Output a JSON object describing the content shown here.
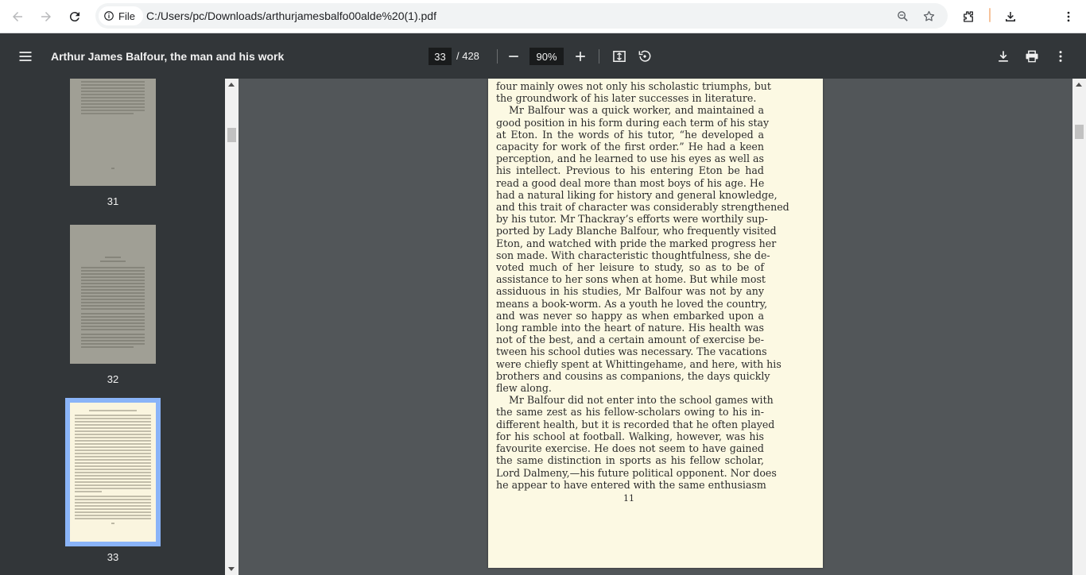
{
  "browser": {
    "site_label": "File",
    "url": "C:/Users/pc/Downloads/arthurjamesbalfo00alde%20(1).pdf",
    "icons": [
      "back-arrow-icon",
      "forward-arrow-icon",
      "reload-icon",
      "info-icon",
      "zoom-icon",
      "star-icon",
      "extensions-icon",
      "download-icon",
      "more-vert-icon"
    ]
  },
  "toolbar": {
    "title": "Arthur James Balfour, the man and his work",
    "current_page": "33",
    "total_pages": "/ 428",
    "zoom": "90%",
    "icons": [
      "menu-icon",
      "zoom-out-icon",
      "zoom-in-icon",
      "fit-page-icon",
      "rotate-icon",
      "download-icon",
      "print-icon",
      "more-vert-icon"
    ]
  },
  "thumbnails": [
    {
      "label": "31",
      "selected": false
    },
    {
      "label": "32",
      "selected": false
    },
    {
      "label": "33",
      "selected": true
    }
  ],
  "page": {
    "lines": [
      {
        "t": "four mainly owes not only his scholastic triumphs, but",
        "indent": false,
        "last": false
      },
      {
        "t": "the groundwork of his later successes in literature.",
        "indent": false,
        "last": true
      },
      {
        "t": "Mr Balfour was a quick worker, and maintained a",
        "indent": true,
        "last": false
      },
      {
        "t": "good position in his form during each term of his stay",
        "indent": false,
        "last": false
      },
      {
        "t": "at Eton.  In the words of his tutor, “he developed a",
        "indent": false,
        "last": false
      },
      {
        "t": "capacity for work of the first order.”  He had a keen",
        "indent": false,
        "last": false
      },
      {
        "t": "perception, and he learned to use his eyes as well as",
        "indent": false,
        "last": false
      },
      {
        "t": "his intellect.  Previous to his entering Eton be had",
        "indent": false,
        "last": false
      },
      {
        "t": "read a good deal more than most boys of his age.  He",
        "indent": false,
        "last": false
      },
      {
        "t": "had a natural liking for history and general knowledge,",
        "indent": false,
        "last": false
      },
      {
        "t": "and this trait of character was considerably strengthened",
        "indent": false,
        "last": false
      },
      {
        "t": "by his tutor.  Mr Thackray’s efforts were worthily sup-",
        "indent": false,
        "last": false
      },
      {
        "t": "ported by Lady Blanche Balfour, who frequently visited",
        "indent": false,
        "last": false
      },
      {
        "t": "Eton, and watched with pride the marked progress her",
        "indent": false,
        "last": false
      },
      {
        "t": "son made.  With characteristic thoughtfulness, she de-",
        "indent": false,
        "last": false
      },
      {
        "t": "voted much of her leisure to study, so as to be of",
        "indent": false,
        "last": false
      },
      {
        "t": "assistance to her sons when at home.  But while most",
        "indent": false,
        "last": false
      },
      {
        "t": "assiduous in his studies, Mr Balfour was not by any",
        "indent": false,
        "last": false
      },
      {
        "t": "means a book-worm.  As a youth he loved the country,",
        "indent": false,
        "last": false
      },
      {
        "t": "and was never so happy as when embarked upon a",
        "indent": false,
        "last": false
      },
      {
        "t": "long ramble into the heart of nature.  His health was",
        "indent": false,
        "last": false
      },
      {
        "t": "not of the best, and a certain amount of exercise be-",
        "indent": false,
        "last": false
      },
      {
        "t": "tween his school duties was necessary.  The vacations",
        "indent": false,
        "last": false
      },
      {
        "t": "were chiefly spent at Whittingehame, and here, with his",
        "indent": false,
        "last": false
      },
      {
        "t": "brothers and cousins as companions, the days quickly",
        "indent": false,
        "last": false
      },
      {
        "t": "flew along.",
        "indent": false,
        "last": true
      },
      {
        "t": "Mr Balfour did not enter into the school games with",
        "indent": true,
        "last": false
      },
      {
        "t": "the same zest as his fellow-scholars owing to his in-",
        "indent": false,
        "last": false
      },
      {
        "t": "different health, but it is recorded that he often played",
        "indent": false,
        "last": false
      },
      {
        "t": "for his school at football.  Walking, however, was his",
        "indent": false,
        "last": false
      },
      {
        "t": "favourite exercise.  He does not seem to have gained",
        "indent": false,
        "last": false
      },
      {
        "t": "the same distinction in sports as his fellow scholar,",
        "indent": false,
        "last": false
      },
      {
        "t": "Lord Dalmeny,—his future political opponent.  Nor does",
        "indent": false,
        "last": false
      },
      {
        "t": "he appear to have entered with the same enthusiasm",
        "indent": false,
        "last": false
      }
    ],
    "page_number": "11"
  }
}
